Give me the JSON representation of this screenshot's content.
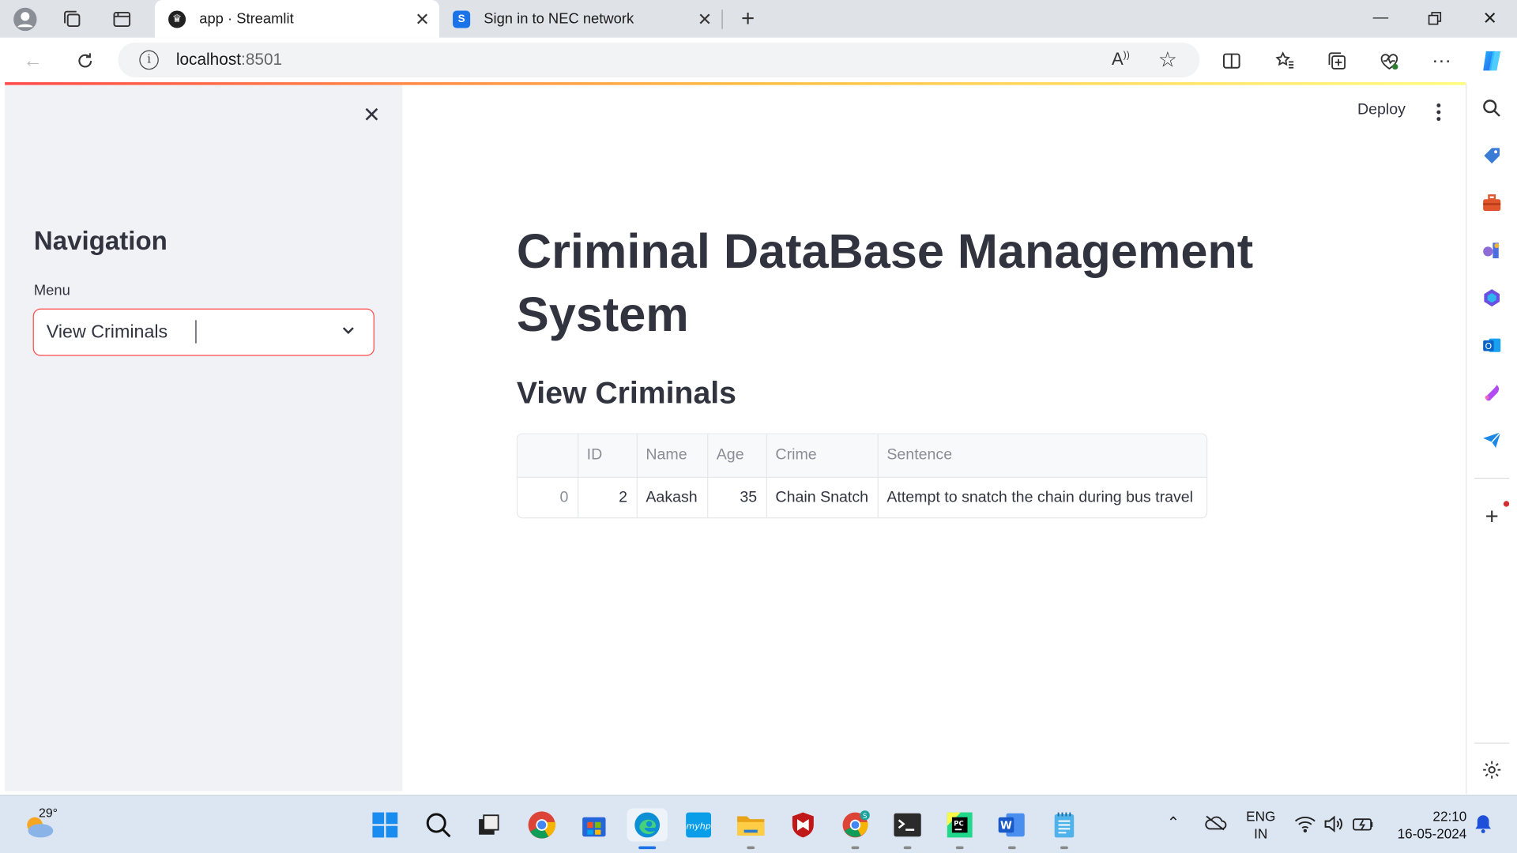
{
  "browser": {
    "tabs": [
      {
        "title": "app · Streamlit",
        "active": true
      },
      {
        "title": "Sign in to NEC network",
        "active": false
      }
    ],
    "url_host": "localhost",
    "url_port": ":8501"
  },
  "sidebar": {
    "title": "Navigation",
    "menu_label": "Menu",
    "menu_value": "View Criminals"
  },
  "main": {
    "deploy_label": "Deploy",
    "page_title": "Criminal DataBase Management System",
    "section_title": "View Criminals",
    "table": {
      "columns": [
        "",
        "ID",
        "Name",
        "Age",
        "Crime",
        "Sentence"
      ],
      "rows": [
        {
          "index": "0",
          "id": "2",
          "name": "Aakash",
          "age": "35",
          "crime": "Chain Snatch",
          "sentence": "Attempt to snatch the chain during bus travel"
        }
      ]
    }
  },
  "taskbar": {
    "weather_temp": "29°",
    "lang_line1": "ENG",
    "lang_line2": "IN",
    "time": "22:10",
    "date": "16-05-2024"
  },
  "colors": {
    "accent": "#ff4b4b",
    "text": "#31333f",
    "sidebar_bg": "#f0f2f6"
  }
}
